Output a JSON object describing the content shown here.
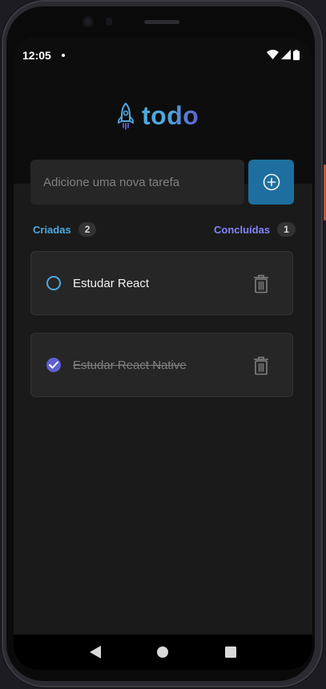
{
  "status_bar": {
    "time": "12:05"
  },
  "app": {
    "title": "todo"
  },
  "new_task": {
    "placeholder": "Adicione uma nova tarefa",
    "value": ""
  },
  "counters": {
    "created_label": "Criadas",
    "created_count": "2",
    "done_label": "Concluídas",
    "done_count": "1"
  },
  "tasks": [
    {
      "text": "Estudar React",
      "done": false
    },
    {
      "text": "Estudar React Native",
      "done": true
    }
  ],
  "icons": {
    "logo": "rocket-icon",
    "add": "plus-circle-icon",
    "delete": "trash-icon",
    "check_empty": "circle-icon",
    "check_done": "check-circle-icon",
    "nav_back": "back-triangle-icon",
    "nav_home": "home-circle-icon",
    "nav_recents": "recents-square-icon"
  },
  "colors": {
    "blue": "#4ea8de",
    "purple": "#5e60ce",
    "purple_light": "#8284fa",
    "blue_dark": "#1e6f9f",
    "background": "#1a1a1a",
    "card": "#262626"
  }
}
